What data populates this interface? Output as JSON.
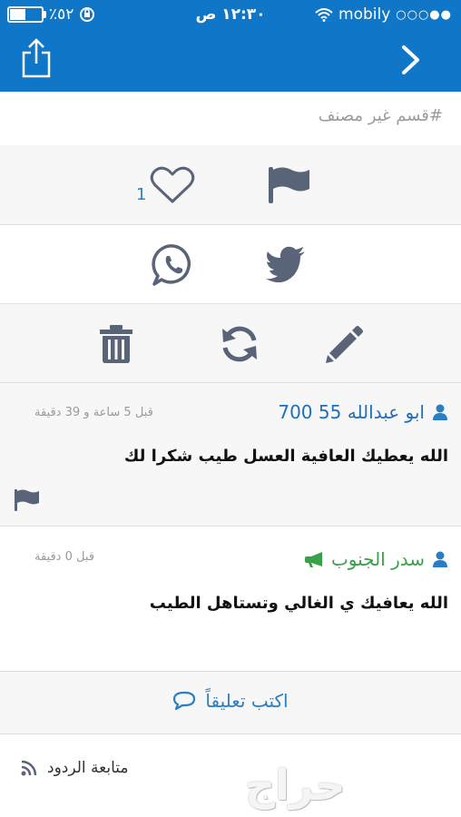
{
  "status_bar": {
    "battery": "٪٥٢",
    "battery_level": 0.52,
    "time": "١٢:٣٠ ص",
    "carrier": "mobily",
    "signal_dots": "○○○●●"
  },
  "category": {
    "label": "#قسم غير مصنف"
  },
  "actions": {
    "like_count": "1"
  },
  "comments": [
    {
      "author": "ابو عبدالله 55 700",
      "time": "قبل 5 ساعة و 39 دقيقة",
      "text": "الله يعطيك العافية العسل طيب شكرا لك"
    },
    {
      "author": "سدر الجنوب",
      "time": "قبل 0 دقيقة",
      "text": "الله يعافيك ي الغالي وتستاهل الطيب"
    }
  ],
  "write_comment": {
    "label": "اكتب تعليقاً"
  },
  "follow": {
    "label": "متابعة الردود"
  },
  "logo": {
    "text": "حراج"
  },
  "colors": {
    "primary": "#0f76c8",
    "icon_gray": "#5a6478",
    "link_blue": "#2a7fc4",
    "green": "#3aa14b"
  }
}
